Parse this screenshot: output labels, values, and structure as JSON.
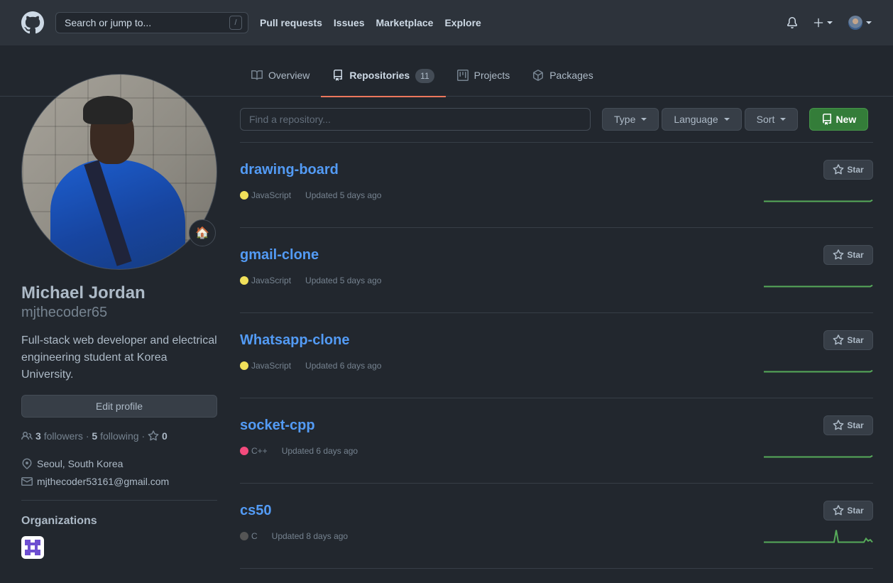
{
  "header": {
    "search_placeholder": "Search or jump to...",
    "search_shortcut": "/",
    "nav": [
      "Pull requests",
      "Issues",
      "Marketplace",
      "Explore"
    ]
  },
  "tabs": [
    {
      "label": "Overview"
    },
    {
      "label": "Repositories",
      "count": "11",
      "active": true
    },
    {
      "label": "Projects"
    },
    {
      "label": "Packages"
    }
  ],
  "profile": {
    "name": "Michael Jordan",
    "username": "mjthecoder65",
    "status_emoji": "🏠",
    "bio": "Full-stack web developer and electrical engineering student at Korea University.",
    "edit_label": "Edit profile",
    "followers_count": "3",
    "followers_label": "followers",
    "following_count": "5",
    "following_label": "following",
    "stars_count": "0",
    "location": "Seoul, South Korea",
    "email": "mjthecoder53161@gmail.com",
    "orgs_title": "Organizations"
  },
  "filters": {
    "find_placeholder": "Find a repository...",
    "type_label": "Type",
    "language_label": "Language",
    "sort_label": "Sort",
    "new_label": "New"
  },
  "repos": [
    {
      "name": "drawing-board",
      "language": "JavaScript",
      "lang_color": "#f1e05a",
      "updated": "Updated 5 days ago",
      "star_label": "Star",
      "activity": [
        0,
        0,
        0,
        0,
        0,
        0,
        0,
        0,
        0,
        0,
        0,
        0,
        0,
        0,
        0,
        0,
        0,
        0,
        0,
        0,
        0,
        0,
        0,
        0,
        0,
        0,
        0,
        0,
        0,
        0,
        0,
        0,
        0,
        0,
        0,
        0,
        0,
        0,
        0,
        0,
        0,
        0,
        0,
        0,
        0,
        0,
        0,
        0,
        0,
        0,
        0,
        1
      ]
    },
    {
      "name": "gmail-clone",
      "language": "JavaScript",
      "lang_color": "#f1e05a",
      "updated": "Updated 5 days ago",
      "star_label": "Star",
      "activity": [
        0,
        0,
        0,
        0,
        0,
        0,
        0,
        0,
        0,
        0,
        0,
        0,
        0,
        0,
        0,
        0,
        0,
        0,
        0,
        0,
        0,
        0,
        0,
        0,
        0,
        0,
        0,
        0,
        0,
        0,
        0,
        0,
        0,
        0,
        0,
        0,
        0,
        0,
        0,
        0,
        0,
        0,
        0,
        0,
        0,
        0,
        0,
        0,
        0,
        0,
        0,
        1
      ]
    },
    {
      "name": "Whatsapp-clone",
      "language": "JavaScript",
      "lang_color": "#f1e05a",
      "updated": "Updated 6 days ago",
      "star_label": "Star",
      "activity": [
        0,
        0,
        0,
        0,
        0,
        0,
        0,
        0,
        0,
        0,
        0,
        0,
        0,
        0,
        0,
        0,
        0,
        0,
        0,
        0,
        0,
        0,
        0,
        0,
        0,
        0,
        0,
        0,
        0,
        0,
        0,
        0,
        0,
        0,
        0,
        0,
        0,
        0,
        0,
        0,
        0,
        0,
        0,
        0,
        0,
        0,
        0,
        0,
        0,
        0,
        0,
        1
      ]
    },
    {
      "name": "socket-cpp",
      "language": "C++",
      "lang_color": "#f34b7d",
      "updated": "Updated 6 days ago",
      "star_label": "Star",
      "activity": [
        0,
        0,
        0,
        0,
        0,
        0,
        0,
        0,
        0,
        0,
        0,
        0,
        0,
        0,
        0,
        0,
        0,
        0,
        0,
        0,
        0,
        0,
        0,
        0,
        0,
        0,
        0,
        0,
        0,
        0,
        0,
        0,
        0,
        0,
        0,
        0,
        0,
        0,
        0,
        0,
        0,
        0,
        0,
        0,
        0,
        0,
        0,
        0,
        0,
        0,
        0,
        1
      ]
    },
    {
      "name": "cs50",
      "language": "C",
      "lang_color": "#555555",
      "updated": "Updated 8 days ago",
      "star_label": "Star",
      "activity": [
        0,
        0,
        0,
        0,
        0,
        0,
        0,
        0,
        0,
        0,
        0,
        0,
        0,
        0,
        0,
        0,
        0,
        0,
        0,
        0,
        0,
        0,
        0,
        0,
        0,
        0,
        0,
        0,
        0,
        0,
        0,
        0,
        0,
        0,
        10,
        0,
        0,
        0,
        0,
        0,
        0,
        0,
        0,
        0,
        0,
        0,
        0,
        0,
        3,
        1,
        2,
        0
      ]
    }
  ],
  "colors": {
    "accent": "#539bf5",
    "tab_underline": "#ec775c",
    "new_button": "#347d39",
    "spark": "#57ab5a"
  }
}
